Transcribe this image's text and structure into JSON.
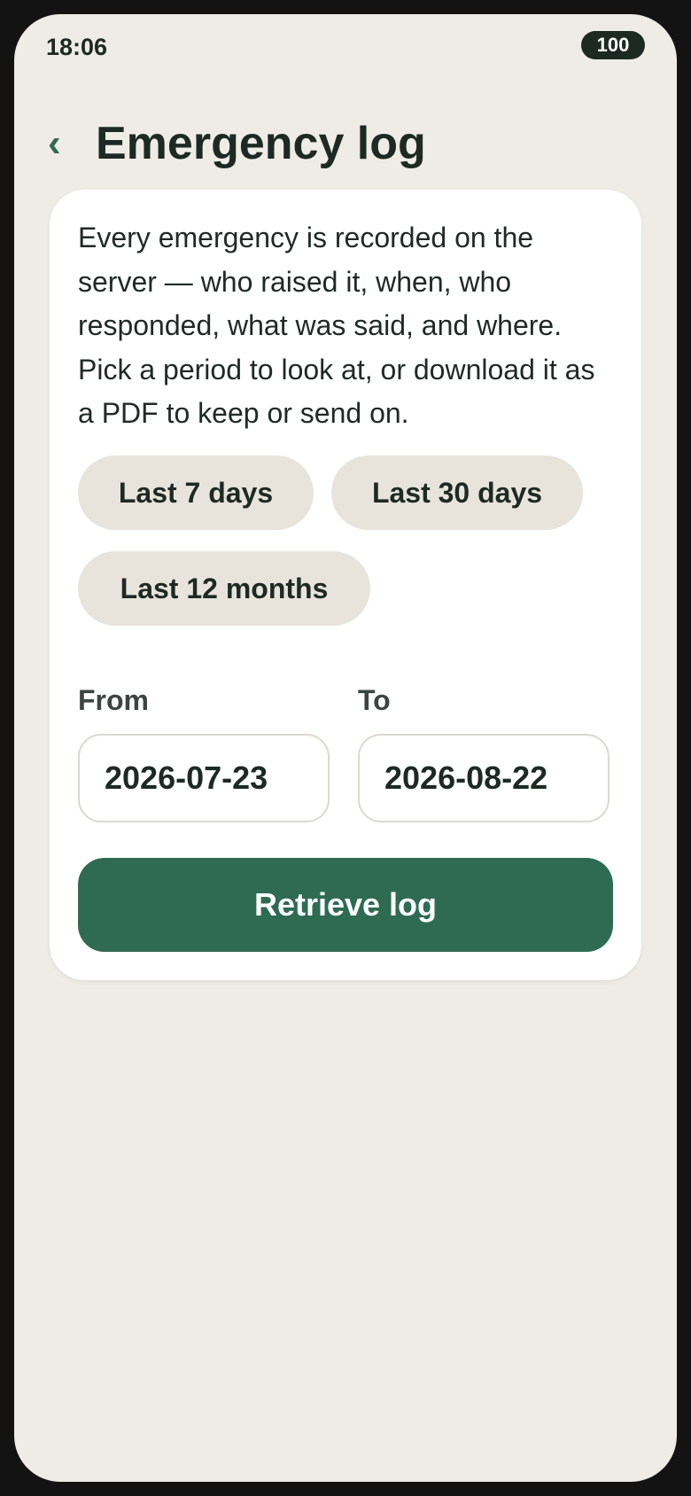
{
  "status_bar": {
    "time": "18:06",
    "battery": "100"
  },
  "header": {
    "back_icon": "‹",
    "title": "Emergency log"
  },
  "card": {
    "intro": "Every emergency is recorded on the server — who raised it, when, who responded, what was said, and where. Pick a period to look at, or download it as a PDF to keep or send on.",
    "presets": [
      {
        "label": "Last 7 days"
      },
      {
        "label": "Last 30 days"
      },
      {
        "label": "Last 12 months"
      }
    ],
    "from_label": "From",
    "from_value": "2026-07-23",
    "to_label": "To",
    "to_value": "2026-08-22",
    "retrieve_label": "Retrieve log"
  },
  "colors": {
    "background": "#efece5",
    "accent": "#2e6b52",
    "chip": "#e9e4db",
    "text": "#1d2a24"
  },
  "icons": {
    "back": "chevron-left-icon"
  }
}
